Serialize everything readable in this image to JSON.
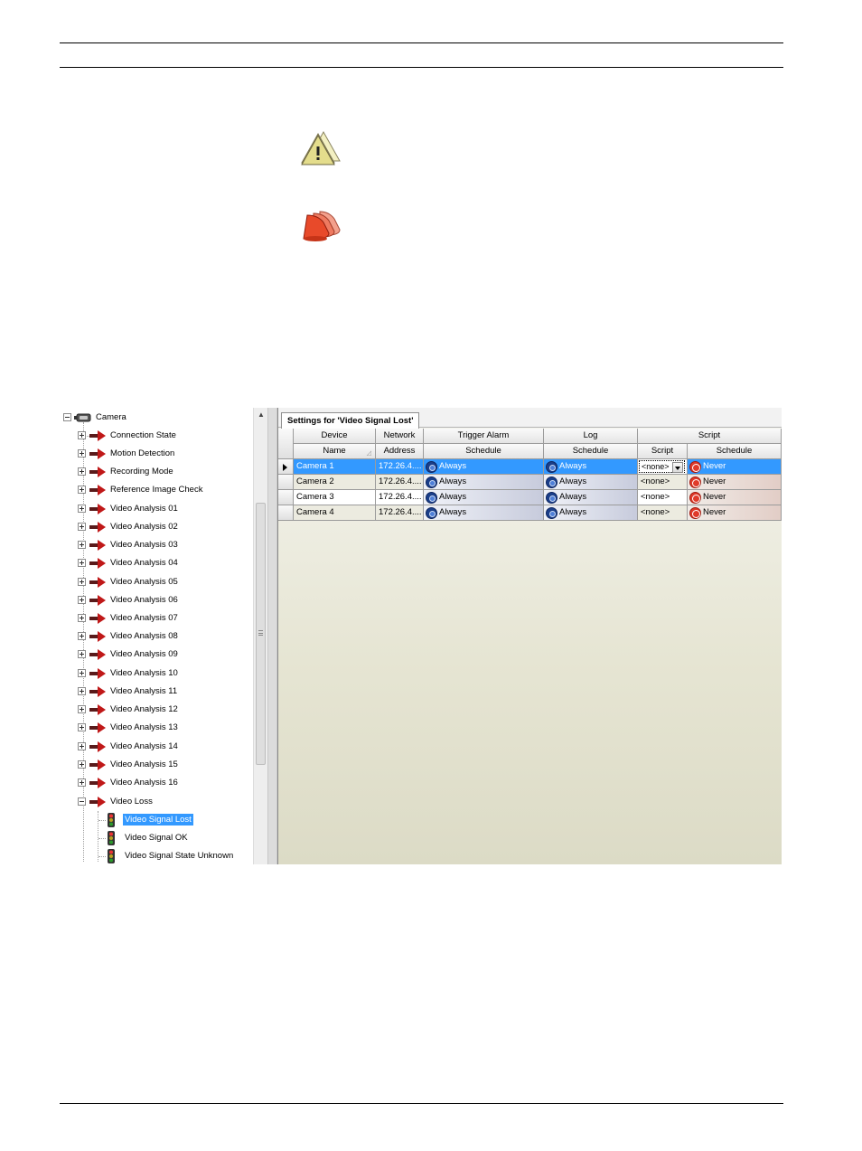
{
  "tree": {
    "root": {
      "label": "Camera",
      "icon": "camera-icon"
    },
    "items": [
      {
        "label": "Connection State",
        "icon": "arrow-icon"
      },
      {
        "label": "Motion Detection",
        "icon": "arrow-icon"
      },
      {
        "label": "Recording Mode",
        "icon": "arrow-icon"
      },
      {
        "label": "Reference Image Check",
        "icon": "arrow-icon"
      },
      {
        "label": "Video Analysis 01",
        "icon": "arrow-icon"
      },
      {
        "label": "Video Analysis 02",
        "icon": "arrow-icon"
      },
      {
        "label": "Video Analysis 03",
        "icon": "arrow-icon"
      },
      {
        "label": "Video Analysis 04",
        "icon": "arrow-icon"
      },
      {
        "label": "Video Analysis 05",
        "icon": "arrow-icon"
      },
      {
        "label": "Video Analysis 06",
        "icon": "arrow-icon"
      },
      {
        "label": "Video Analysis 07",
        "icon": "arrow-icon"
      },
      {
        "label": "Video Analysis 08",
        "icon": "arrow-icon"
      },
      {
        "label": "Video Analysis 09",
        "icon": "arrow-icon"
      },
      {
        "label": "Video Analysis 10",
        "icon": "arrow-icon"
      },
      {
        "label": "Video Analysis 11",
        "icon": "arrow-icon"
      },
      {
        "label": "Video Analysis 12",
        "icon": "arrow-icon"
      },
      {
        "label": "Video Analysis 13",
        "icon": "arrow-icon"
      },
      {
        "label": "Video Analysis 14",
        "icon": "arrow-icon"
      },
      {
        "label": "Video Analysis 15",
        "icon": "arrow-icon"
      },
      {
        "label": "Video Analysis 16",
        "icon": "arrow-icon"
      },
      {
        "label": "Video Loss",
        "icon": "arrow-icon"
      }
    ],
    "video_loss_children": [
      {
        "label": "Video Signal Lost",
        "icon": "traffic-light-icon",
        "selected": true
      },
      {
        "label": "Video Signal OK",
        "icon": "traffic-light-icon",
        "selected": false
      },
      {
        "label": "Video Signal State Unknown",
        "icon": "traffic-light-icon",
        "selected": false
      }
    ]
  },
  "settings": {
    "tab_label": "Settings for 'Video Signal Lost'",
    "group_headers": {
      "device": "Device",
      "network": "Network",
      "trigger_alarm": "Trigger Alarm",
      "log": "Log",
      "script": "Script"
    },
    "column_headers": {
      "name": "Name",
      "address": "Address",
      "trigger_schedule": "Schedule",
      "log_schedule": "Schedule",
      "script": "Script",
      "script_schedule": "Schedule"
    },
    "rows": [
      {
        "name": "Camera 1",
        "address": "172.26.4....",
        "trigger": "Always",
        "log": "Always",
        "script": "<none>",
        "script_schedule": "Never"
      },
      {
        "name": "Camera 2",
        "address": "172.26.4....",
        "trigger": "Always",
        "log": "Always",
        "script": "<none>",
        "script_schedule": "Never"
      },
      {
        "name": "Camera 3",
        "address": "172.26.4....",
        "trigger": "Always",
        "log": "Always",
        "script": "<none>",
        "script_schedule": "Never"
      },
      {
        "name": "Camera 4",
        "address": "172.26.4....",
        "trigger": "Always",
        "log": "Always",
        "script": "<none>",
        "script_schedule": "Never"
      }
    ]
  },
  "colors": {
    "selection": "#3399ff",
    "warning_icon": "#e8e49a",
    "alarm_icon": "#e84a2a"
  }
}
